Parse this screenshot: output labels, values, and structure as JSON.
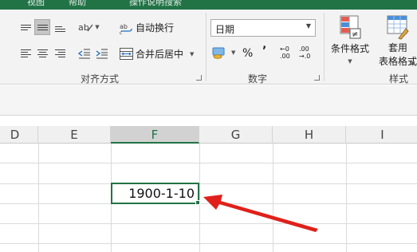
{
  "titlebar": {
    "items": [
      "视图",
      "帮助",
      "操作说明搜索"
    ]
  },
  "alignment": {
    "wrap_text": "自动换行",
    "merge_center": "合并后居中",
    "group_label": "对齐方式"
  },
  "number": {
    "format_value": "日期",
    "percent_symbol": "%",
    "comma_symbol": "’",
    "increase_decimal_top": "←0",
    "increase_decimal_bottom": ".00",
    "decrease_decimal_top": ".00",
    "decrease_decimal_bottom": "→.0",
    "group_label": "数字"
  },
  "styles": {
    "conditional_format": "条件格式",
    "table_format_line1": "套用",
    "table_format_line2": "表格格式",
    "group_label": "样式"
  },
  "columns": [
    "D",
    "E",
    "F",
    "G",
    "H",
    "I"
  ],
  "selected_column": "F",
  "active_cell": {
    "value": "1900-1-10"
  },
  "colors": {
    "excel_green": "#217346",
    "arrow_red": "#e0201a"
  }
}
